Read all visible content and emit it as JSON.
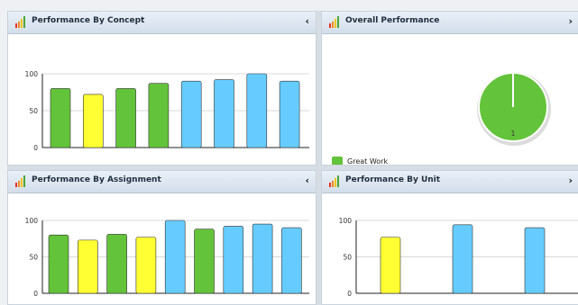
{
  "colors": {
    "green": "#63c33a",
    "yellow": "#ffff33",
    "blue": "#66ccff",
    "gridline": "#d9d9d9",
    "axis": "#222222"
  },
  "panels": {
    "concept": {
      "title": "Performance By Concept",
      "toggle_icon": "chevron-left-icon",
      "toggle": "‹"
    },
    "overall": {
      "title": "Overall Performance",
      "toggle_icon": "chevron-right-icon",
      "toggle": "›",
      "legend_label": "Great Work",
      "pie_label": "1"
    },
    "assignment": {
      "title": "Performance By Assignment",
      "toggle_icon": "chevron-left-icon",
      "toggle": "‹"
    },
    "unit": {
      "title": "Performance By Unit",
      "toggle_icon": "chevron-right-icon",
      "toggle": "›"
    }
  },
  "chart_data": [
    {
      "type": "bar",
      "title": "Performance By Concept",
      "yticks": [
        0,
        50,
        100
      ],
      "ylim": [
        0,
        100
      ],
      "grid": true,
      "values": [
        80,
        72,
        80,
        87,
        90,
        92,
        100,
        90
      ],
      "colors": [
        "green",
        "yellow",
        "green",
        "green",
        "blue",
        "blue",
        "blue",
        "blue"
      ]
    },
    {
      "type": "pie",
      "title": "Overall Performance",
      "legend": [
        "Great Work"
      ],
      "values": [
        1
      ],
      "labels": [
        "1"
      ],
      "colors": [
        "green"
      ]
    },
    {
      "type": "bar",
      "title": "Performance By Assignment",
      "yticks": [
        0,
        50,
        100
      ],
      "ylim": [
        0,
        100
      ],
      "grid": true,
      "values": [
        80,
        73,
        81,
        77,
        100,
        88,
        92,
        95,
        90
      ],
      "colors": [
        "green",
        "yellow",
        "green",
        "yellow",
        "blue",
        "green",
        "blue",
        "blue",
        "blue"
      ]
    },
    {
      "type": "bar",
      "title": "Performance By Unit",
      "yticks": [
        0,
        50,
        100
      ],
      "ylim": [
        0,
        100
      ],
      "grid": true,
      "values": [
        77,
        94,
        90
      ],
      "colors": [
        "yellow",
        "blue",
        "blue"
      ]
    }
  ]
}
